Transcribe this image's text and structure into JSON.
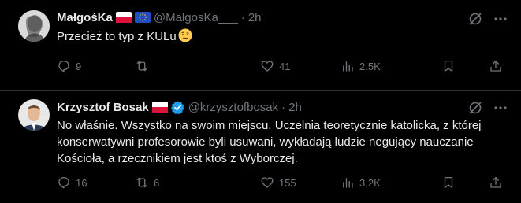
{
  "tweets": [
    {
      "display_name": "MałgośKa",
      "handle": "@MalgosKa___",
      "dot": "·",
      "time": "2h",
      "text": "Przecież to typ z KULu",
      "emoji": "raised-eyebrow-emoji",
      "replies": "9",
      "retweets": "",
      "likes": "41",
      "views": "2.5K",
      "flags": [
        "poland-flag",
        "eu-flag"
      ]
    },
    {
      "display_name": "Krzysztof Bosak",
      "handle": "@krzysztofbosak",
      "dot": "·",
      "time": "2h",
      "text": "No właśnie. Wszystko na swoim miejscu. Uczelnia teoretycznie katolicka, z której konserwatywni profesorowie byli usuwani, wykładają ludzie negujący nauczanie Kościoła, a rzecznikiem jest ktoś z Wyborczej.",
      "replies": "16",
      "retweets": "6",
      "likes": "155",
      "views": "3.2K",
      "flags": [
        "poland-flag"
      ],
      "verified": true
    }
  ],
  "colors": {
    "background": "#000000",
    "text": "#e7e9ea",
    "muted": "#71767b",
    "divider": "#2f3336",
    "verified": "#1d9bf0"
  }
}
